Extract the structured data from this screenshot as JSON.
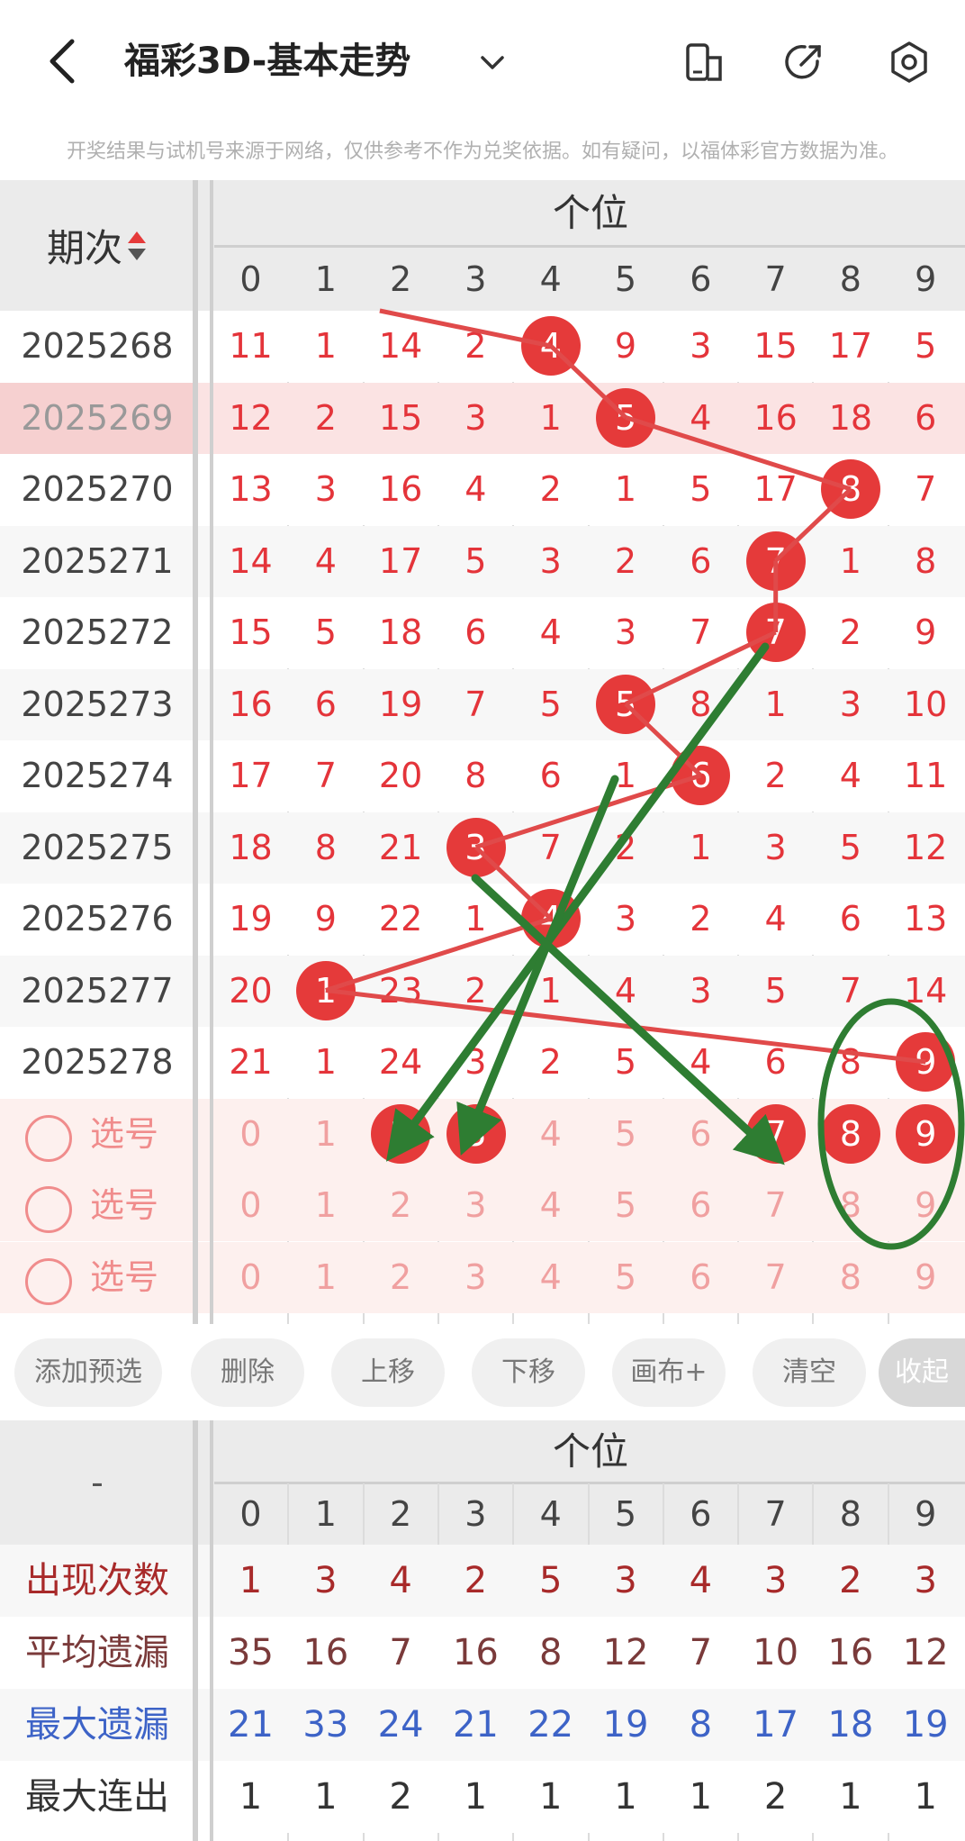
{
  "header": {
    "title": "福彩3D-基本走势",
    "notice": "开奖结果与试机号来源于网络，仅供参考不作为兑奖依据。如有疑问，以福体彩官方数据为准。"
  },
  "table": {
    "period_label": "期次",
    "position_label": "个位",
    "digits": [
      "0",
      "1",
      "2",
      "3",
      "4",
      "5",
      "6",
      "7",
      "8",
      "9"
    ],
    "rows": [
      {
        "period": "2025268",
        "cells": [
          "11",
          "1",
          "14",
          "2",
          "4",
          "9",
          "3",
          "15",
          "17",
          "5"
        ],
        "hit": 4
      },
      {
        "period": "2025269",
        "cells": [
          "12",
          "2",
          "15",
          "3",
          "1",
          "5",
          "4",
          "16",
          "18",
          "6"
        ],
        "hit": 5
      },
      {
        "period": "2025270",
        "cells": [
          "13",
          "3",
          "16",
          "4",
          "2",
          "1",
          "5",
          "17",
          "8",
          "7"
        ],
        "hit": 8
      },
      {
        "period": "2025271",
        "cells": [
          "14",
          "4",
          "17",
          "5",
          "3",
          "2",
          "6",
          "7",
          "1",
          "8"
        ],
        "hit": 7
      },
      {
        "period": "2025272",
        "cells": [
          "15",
          "5",
          "18",
          "6",
          "4",
          "3",
          "7",
          "7",
          "2",
          "9"
        ],
        "hit": 7
      },
      {
        "period": "2025273",
        "cells": [
          "16",
          "6",
          "19",
          "7",
          "5",
          "5",
          "8",
          "1",
          "3",
          "10"
        ],
        "hit": 5
      },
      {
        "period": "2025274",
        "cells": [
          "17",
          "7",
          "20",
          "8",
          "6",
          "1",
          "6",
          "2",
          "4",
          "11"
        ],
        "hit": 6
      },
      {
        "period": "2025275",
        "cells": [
          "18",
          "8",
          "21",
          "3",
          "7",
          "2",
          "1",
          "3",
          "5",
          "12"
        ],
        "hit": 3
      },
      {
        "period": "2025276",
        "cells": [
          "19",
          "9",
          "22",
          "1",
          "",
          "3",
          "2",
          "4",
          "6",
          "13"
        ],
        "hit": 4
      },
      {
        "period": "2025277",
        "cells": [
          "20",
          "1",
          "23",
          "2",
          "1",
          "4",
          "3",
          "5",
          "7",
          "14"
        ],
        "hit": 1
      },
      {
        "period": "2025278",
        "cells": [
          "21",
          "1",
          "24",
          "3",
          "2",
          "5",
          "4",
          "6",
          "8",
          "9"
        ],
        "hit": 9
      }
    ],
    "select_label": "选号",
    "select_rows": [
      {
        "balls": [
          2,
          3,
          7,
          8,
          9
        ]
      },
      {
        "balls": []
      },
      {
        "balls": []
      }
    ]
  },
  "toolbar": {
    "buttons": [
      "添加预选",
      "删除",
      "上移",
      "下移",
      "画布+",
      "清空",
      "收起"
    ]
  },
  "stats": {
    "dash": "-",
    "position_label": "个位",
    "rows": [
      {
        "label": "出现次数",
        "color": "#a82a2a",
        "values": [
          "1",
          "3",
          "4",
          "2",
          "5",
          "3",
          "4",
          "3",
          "2",
          "3"
        ]
      },
      {
        "label": "平均遗漏",
        "color": "#7a3a3a",
        "values": [
          "35",
          "16",
          "7",
          "16",
          "8",
          "12",
          "7",
          "10",
          "16",
          "12"
        ]
      },
      {
        "label": "最大遗漏",
        "color": "#3d63c7",
        "values": [
          "21",
          "33",
          "24",
          "21",
          "22",
          "19",
          "8",
          "17",
          "18",
          "19"
        ]
      },
      {
        "label": "最大连出",
        "color": "#333333",
        "values": [
          "1",
          "1",
          "2",
          "1",
          "1",
          "1",
          "1",
          "2",
          "1",
          "1"
        ]
      }
    ]
  },
  "colors": {
    "ball": "#e53a3a",
    "trend_line": "#e04a4a",
    "annotation": "#2e7d32",
    "highlight_row": "#fbe3e3",
    "select_bg": "#fdf0ee"
  }
}
